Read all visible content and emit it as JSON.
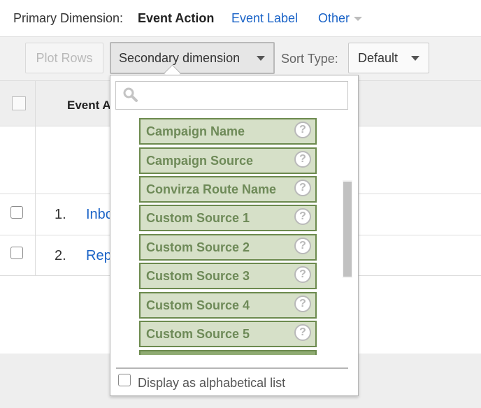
{
  "primary_dimension": {
    "label": "Primary Dimension:",
    "active": "Event Action",
    "links": [
      "Event Label",
      "Other"
    ]
  },
  "toolbar": {
    "plot_rows": "Plot Rows",
    "secondary_dimension": "Secondary dimension",
    "sort_type_label": "Sort Type:",
    "sort_type_value": "Default"
  },
  "table": {
    "header": "Event A",
    "rows": [
      {
        "num": "1.",
        "text": "Inbo"
      },
      {
        "num": "2.",
        "text": "Rep"
      }
    ]
  },
  "dropdown": {
    "search_placeholder": "",
    "items": [
      "Campaign Name",
      "Campaign Source",
      "Convirza Route Name",
      "Custom Source 1",
      "Custom Source 2",
      "Custom Source 3",
      "Custom Source 4",
      "Custom Source 5"
    ],
    "help_glyph": "?",
    "alphabetical_label": "Display as alphabetical list"
  },
  "colors": {
    "link": "#1a63c7",
    "item_bg": "#d6e0c8",
    "item_border": "#6c8a4e",
    "item_text": "#6e8a58"
  },
  "icons": {
    "search": "search-icon",
    "help": "help-icon",
    "caret": "chevron-down-icon"
  }
}
